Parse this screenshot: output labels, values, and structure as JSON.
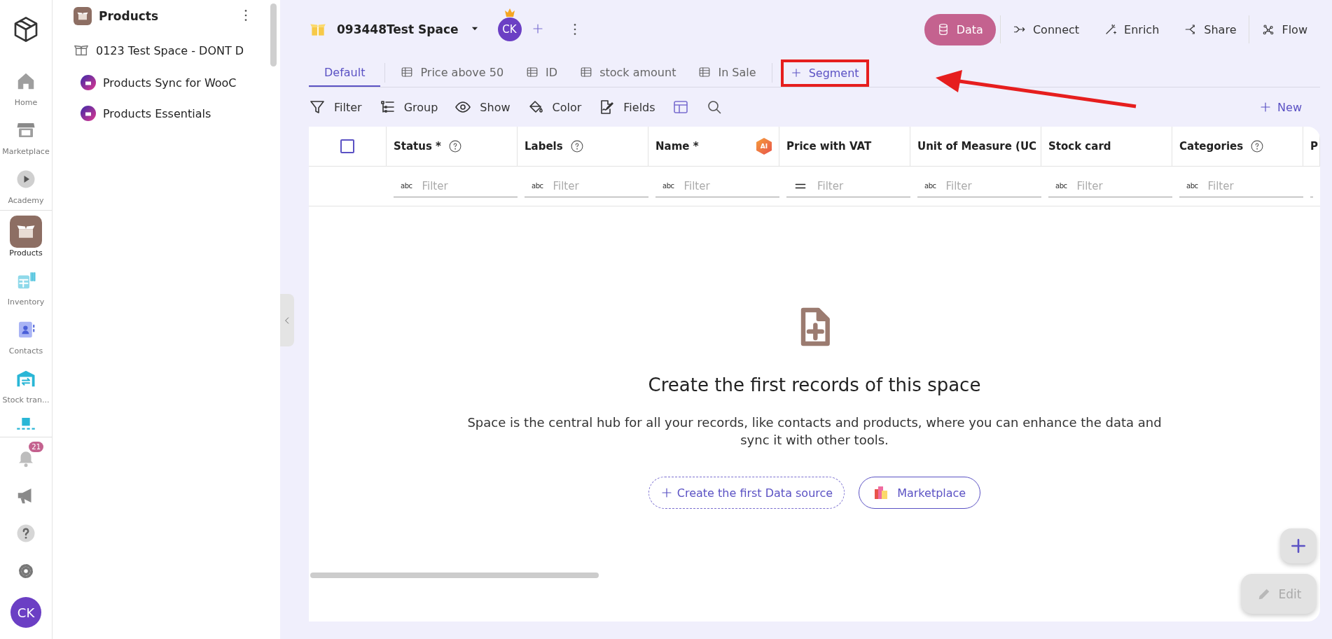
{
  "nav_rail": {
    "items": [
      {
        "kind": "home",
        "label": "Home",
        "selected": false
      },
      {
        "kind": "store",
        "label": "Marketplace",
        "selected": false
      },
      {
        "kind": "play",
        "label": "Academy",
        "selected": false
      },
      {
        "kind": "box",
        "label": "Products",
        "selected": true
      },
      {
        "kind": "inventory",
        "label": "Inventory",
        "selected": false
      },
      {
        "kind": "contacts",
        "label": "Contacts",
        "selected": false
      },
      {
        "kind": "warehouse",
        "label": "Stock tran...",
        "selected": false
      },
      {
        "kind": "shelf",
        "selected": false
      }
    ],
    "bottom": [
      {
        "kind": "bell",
        "badge": "21"
      },
      {
        "kind": "megaphone"
      },
      {
        "kind": "help"
      },
      {
        "kind": "settings"
      },
      {
        "kind": "avatar",
        "initials": "CK"
      }
    ]
  },
  "sidebar": {
    "title": "Products",
    "tree": [
      {
        "label": "0123 Test Space - DONT D",
        "children": [
          {
            "label": "Products Sync for WooC"
          },
          {
            "label": "Products Essentials"
          }
        ]
      }
    ]
  },
  "header": {
    "space_name": "093448Test Space",
    "member_initials": "CK",
    "actions": [
      {
        "kind": "data",
        "label": "Data",
        "selected": true
      },
      {
        "kind": "connect",
        "label": "Connect",
        "selected": false
      },
      {
        "kind": "enrich",
        "label": "Enrich",
        "selected": false
      },
      {
        "kind": "share",
        "label": "Share",
        "selected": false
      },
      {
        "kind": "flow",
        "label": "Flow",
        "selected": false
      }
    ]
  },
  "segments": [
    {
      "label": "Default",
      "selected": true
    },
    {
      "label": "Price above 50",
      "selected": false
    },
    {
      "label": "ID",
      "selected": false
    },
    {
      "label": "stock amount",
      "selected": false
    },
    {
      "label": "In Sale",
      "selected": false
    }
  ],
  "add_segment": "Segment",
  "toolbar": {
    "items": [
      {
        "kind": "filter",
        "label": "Filter"
      },
      {
        "kind": "group",
        "label": "Group"
      },
      {
        "kind": "show",
        "label": "Show"
      },
      {
        "kind": "color",
        "label": "Color"
      },
      {
        "kind": "fields",
        "label": "Fields"
      }
    ],
    "new_label": "New"
  },
  "table": {
    "columns": [
      {
        "label": "Status *",
        "help": true,
        "kind": "text",
        "type_glyph": "abc",
        "placeholder": "Filter"
      },
      {
        "label": "Labels",
        "help": true,
        "kind": "text",
        "type_glyph": "abc",
        "placeholder": "Filter"
      },
      {
        "label": "Name *",
        "help": false,
        "ai_badge": "AI",
        "kind": "text",
        "type_glyph": "abc",
        "placeholder": "Filter"
      },
      {
        "label": "Price with VAT",
        "help": false,
        "kind": "number",
        "placeholder": "Filter"
      },
      {
        "label": "Unit of Measure (UC",
        "help": false,
        "kind": "text",
        "type_glyph": "abc",
        "placeholder": "Filter"
      },
      {
        "label": "Stock card",
        "help": false,
        "kind": "text",
        "type_glyph": "abc",
        "placeholder": "Filter"
      },
      {
        "label": "Categories",
        "help": true,
        "kind": "text",
        "type_glyph": "abc",
        "placeholder": "Filter"
      },
      {
        "label": "P",
        "help": false,
        "kind": "cut"
      }
    ],
    "select_all": {
      "checked": false
    }
  },
  "empty_state": {
    "title": "Create the first records of this space",
    "description": "Space is the central hub for all your records, like contacts and products, where you can enhance the data and sync it with other tools.",
    "primary": "Create the first Data source",
    "secondary": "Marketplace"
  },
  "edit_button": "Edit"
}
